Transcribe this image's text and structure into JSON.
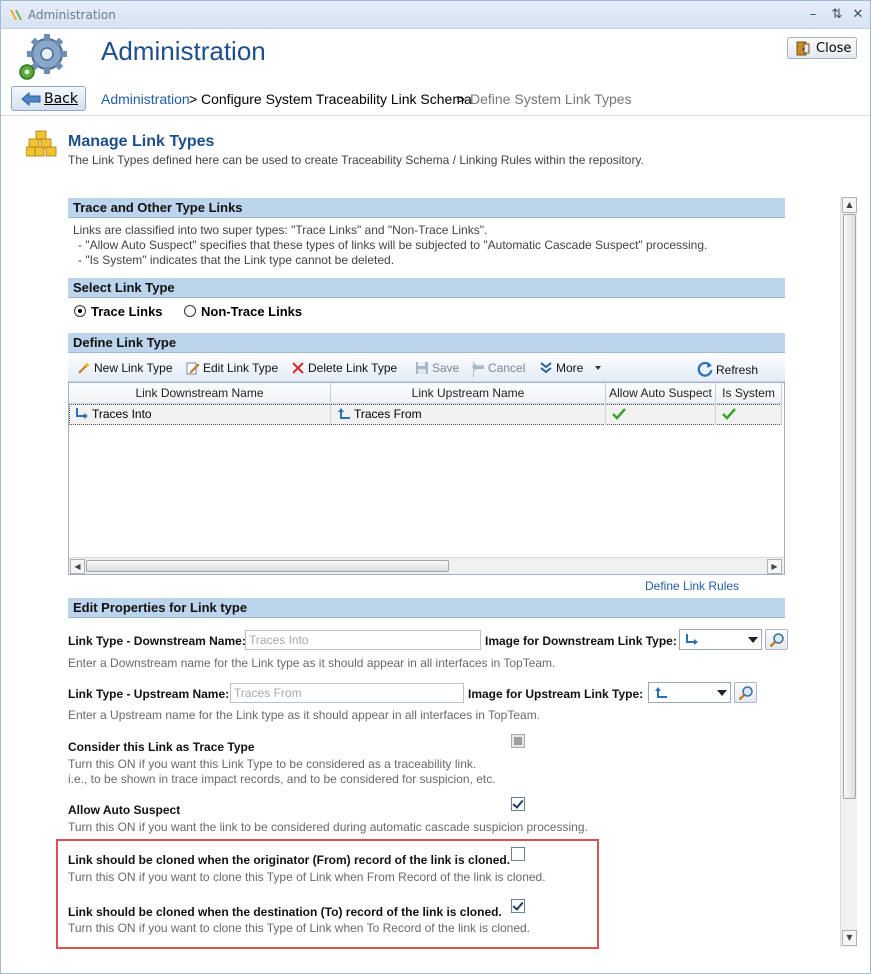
{
  "window": {
    "title": "Administration"
  },
  "header": {
    "title": "Administration",
    "close_label": "Close",
    "back_label": "Back",
    "breadcrumb": {
      "root": "Administration",
      "sep1": ">",
      "middle": "Configure System Traceability Link Schema",
      "sep2": ">",
      "current": "Define System Link Types"
    }
  },
  "page": {
    "title": "Manage Link Types",
    "subtitle": "The Link Types defined here can be used to create Traceability Schema / Linking Rules within the repository."
  },
  "sections": {
    "trace_other": {
      "title": "Trace and Other Type Links",
      "lines": [
        "Links are classified into two super types: \"Trace Links\" and \"Non-Trace Links\".",
        "- \"Allow Auto Suspect\" specifies that these types of links will be subjected to \"Automatic Cascade Suspect\" processing.",
        "- \"Is System\" indicates that the Link type cannot be deleted."
      ]
    },
    "select_type": {
      "title": "Select Link Type",
      "options": [
        "Trace Links",
        "Non-Trace Links"
      ],
      "selected": "Trace Links"
    },
    "define_type": {
      "title": "Define Link Type",
      "toolbar": {
        "new": "New Link Type",
        "edit": "Edit Link Type",
        "delete": "Delete Link Type",
        "save": "Save",
        "cancel": "Cancel",
        "more": "More",
        "refresh": "Refresh"
      },
      "columns": [
        "Link Downstream Name",
        "Link Upstream Name",
        "Allow Auto Suspect",
        "Is System"
      ],
      "rows": [
        {
          "downstream": "Traces Into",
          "upstream": "Traces From",
          "allow_auto_suspect": true,
          "is_system": true
        }
      ],
      "define_rules_link": "Define Link Rules"
    },
    "edit_props": {
      "title": "Edit Properties for Link type",
      "downstream_label": "Link Type - Downstream Name:",
      "downstream_value": "Traces Into",
      "downstream_image_label": "Image for Downstream Link Type:",
      "downstream_help": "Enter a Downstream name for the Link type as it should appear in all interfaces in TopTeam.",
      "upstream_label": "Link Type - Upstream Name:",
      "upstream_value": "Traces From",
      "upstream_image_label": "Image for Upstream Link Type:",
      "upstream_help": "Enter a Upstream name for the Link type as it should appear in all interfaces in TopTeam.",
      "trace_type_label": "Consider this Link as Trace Type",
      "trace_type_help1": "Turn this ON if you want this Link Type to be considered as a traceability link.",
      "trace_type_help2": "i.e., to be shown in trace impact records, and to be considered for suspicion, etc.",
      "trace_type_checked": true,
      "auto_suspect_label": "Allow Auto Suspect",
      "auto_suspect_help": "Turn this ON if you want the link to be considered during automatic cascade suspicion processing.",
      "auto_suspect_checked": true,
      "clone_from_label": "Link should be cloned when the originator (From) record of the link is cloned.",
      "clone_from_help": "Turn this ON if you want to clone this Type of Link when From Record of the link is cloned.",
      "clone_from_checked": false,
      "clone_to_label": "Link should be cloned when the destination (To) record of the link is cloned.",
      "clone_to_help": "Turn this ON if you want to clone this Type of Link when To Record of the link is cloned.",
      "clone_to_checked": true
    }
  },
  "colors": {
    "accent": "#1f4e8c",
    "section_bg": "#bcd4ec",
    "link": "#1f5fa8",
    "highlight": "#d9534f"
  }
}
